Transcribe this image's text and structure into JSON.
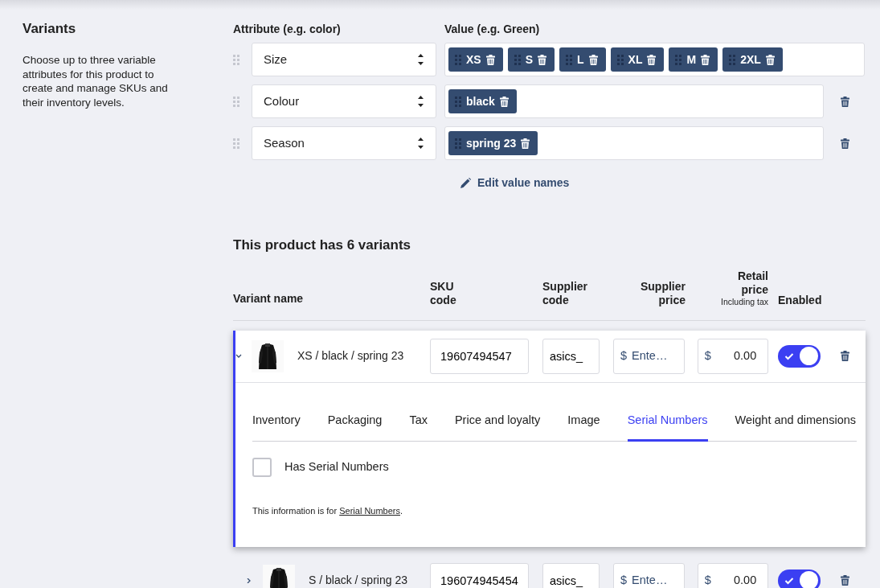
{
  "section": {
    "title": "Variants",
    "description": "Choose up to three variable attributes for this product to create and manage SKUs and their inventory levels."
  },
  "attribute_header": "Attribute (e.g. color)",
  "value_header": "Value (e.g. Green)",
  "attributes": [
    {
      "name": "Size",
      "values": [
        "XS",
        "S",
        "L",
        "XL",
        "M",
        "2XL"
      ],
      "removable": false
    },
    {
      "name": "Colour",
      "values": [
        "black"
      ],
      "removable": true
    },
    {
      "name": "Season",
      "values": [
        "spring 23"
      ],
      "removable": true
    }
  ],
  "edit_link": "Edit value names",
  "variants_title": "This product has 6 variants",
  "columns": [
    {
      "label": "Variant name"
    },
    {
      "label": "SKU code"
    },
    {
      "label": "Supplier code"
    },
    {
      "label": "Supplier price"
    },
    {
      "label": "Retail price",
      "note": "Including tax"
    },
    {
      "label": "Enabled"
    }
  ],
  "variants": [
    {
      "name": "XS / black / spring 23",
      "sku": "19607494547",
      "supplier_code": "asics_",
      "currency": "$",
      "supplier_price_placeholder": "Ente…",
      "retail_price": "0.00",
      "enabled": true,
      "expanded": true,
      "tabs": [
        {
          "label": "Inventory",
          "selected": false
        },
        {
          "label": "Packaging",
          "selected": false
        },
        {
          "label": "Tax",
          "selected": false
        },
        {
          "label": "Price and loyalty",
          "selected": false
        },
        {
          "label": "Image",
          "selected": false
        },
        {
          "label": "Serial Numbers",
          "selected": true
        },
        {
          "label": "Weight and dimensions",
          "selected": false
        }
      ],
      "checkbox": {
        "label": "Has Serial Numbers",
        "checked": false
      },
      "info": {
        "text": "This information is for ",
        "link": "Serial Numbers",
        "end": "."
      }
    },
    {
      "name": "S / black / spring 23",
      "sku": "196074945454",
      "supplier_code": "asics_",
      "currency": "$",
      "supplier_price_placeholder": "Ente…",
      "retail_price": "0.00",
      "enabled": true,
      "expanded": false
    }
  ]
}
